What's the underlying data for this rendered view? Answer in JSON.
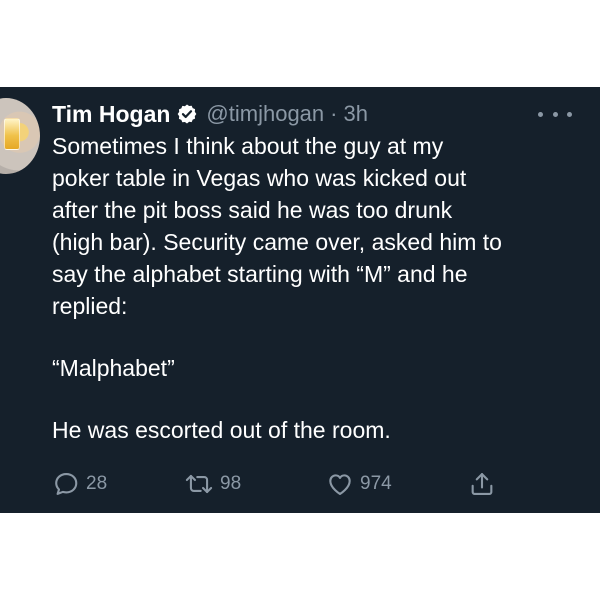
{
  "author": {
    "name": "Tim Hogan",
    "handle": "@timjhogan",
    "separator": "·",
    "time": "3h"
  },
  "tweet": {
    "lines": [
      "Sometimes I think about the guy at my",
      "poker table in Vegas who was kicked out",
      "after the pit boss said he was too drunk",
      "(high bar). Security came over, asked him to",
      "say the alphabet starting with “M” and he",
      "replied:"
    ],
    "quote": "“Malphabet”",
    "closing": "He was escorted out of the room."
  },
  "actions": {
    "replies": "28",
    "retweets": "98",
    "likes": "974"
  },
  "colors": {
    "background": "#15202b",
    "text": "#ffffff",
    "muted": "#8b98a5"
  },
  "icons": {
    "verified": "verified-badge-icon",
    "more": "more-dots-icon",
    "reply": "reply-bubble-icon",
    "retweet": "retweet-icon",
    "like": "heart-icon",
    "share": "share-upload-icon"
  }
}
